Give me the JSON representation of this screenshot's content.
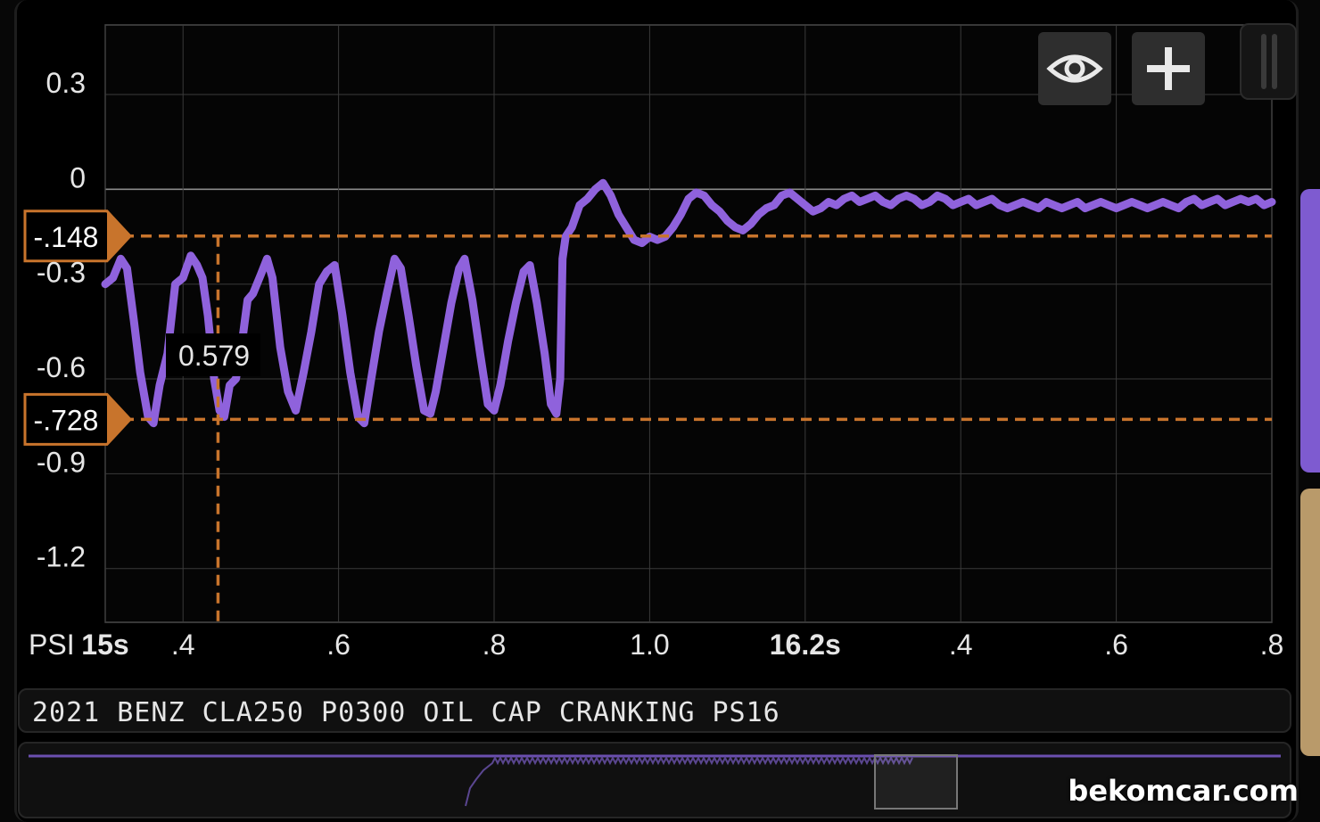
{
  "title_bar": {
    "text": "2021 BENZ CLA250 P0300 OIL CAP CRANKING PS16"
  },
  "toolbar": {
    "eye_icon": "eye-icon",
    "plus_icon": "plus-icon"
  },
  "watermark": "bekomcar.com",
  "colors": {
    "trace": "#8f62dc",
    "cursor": "#c8742c",
    "grid": "#3a3a3a",
    "background": "#000000"
  },
  "chart_data": {
    "type": "line",
    "ylabel": "PSI",
    "ylim": [
      -1.37,
      0.52
    ],
    "xlim": [
      15.3,
      16.8
    ],
    "y_ticks": [
      {
        "value": 0.3,
        "label": "0.3"
      },
      {
        "value": 0,
        "label": "0"
      },
      {
        "value": -0.3,
        "label": "-0.3"
      },
      {
        "value": -0.6,
        "label": "-0.6"
      },
      {
        "value": -0.9,
        "label": "-0.9"
      },
      {
        "value": -1.2,
        "label": "-1.2"
      }
    ],
    "x_ticks": [
      {
        "value": 15.3,
        "label": "15s",
        "bold": true
      },
      {
        "value": 15.4,
        "label": ".4"
      },
      {
        "value": 15.6,
        "label": ".6"
      },
      {
        "value": 15.8,
        "label": ".8"
      },
      {
        "value": 16.0,
        "label": "1.0"
      },
      {
        "value": 16.2,
        "label": "16.2s",
        "bold": true
      },
      {
        "value": 16.4,
        "label": ".4"
      },
      {
        "value": 16.6,
        "label": ".6"
      },
      {
        "value": 16.8,
        "label": ".8"
      }
    ],
    "cursors": {
      "horizontal": [
        {
          "value": -0.148,
          "label": "-.148"
        },
        {
          "value": -0.728,
          "label": "-.728"
        }
      ],
      "vertical": {
        "x": 15.445,
        "delta_label": "0.579"
      }
    },
    "series": [
      {
        "color": "#8f62dc",
        "points": [
          [
            15.3,
            -0.3
          ],
          [
            15.31,
            -0.28
          ],
          [
            15.32,
            -0.22
          ],
          [
            15.328,
            -0.25
          ],
          [
            15.337,
            -0.42
          ],
          [
            15.345,
            -0.58
          ],
          [
            15.355,
            -0.72
          ],
          [
            15.362,
            -0.74
          ],
          [
            15.37,
            -0.62
          ],
          [
            15.38,
            -0.52
          ],
          [
            15.39,
            -0.3
          ],
          [
            15.4,
            -0.28
          ],
          [
            15.41,
            -0.21
          ],
          [
            15.418,
            -0.24
          ],
          [
            15.425,
            -0.28
          ],
          [
            15.432,
            -0.4
          ],
          [
            15.44,
            -0.6
          ],
          [
            15.447,
            -0.7
          ],
          [
            15.453,
            -0.72
          ],
          [
            15.46,
            -0.62
          ],
          [
            15.468,
            -0.6
          ],
          [
            15.475,
            -0.5
          ],
          [
            15.483,
            -0.35
          ],
          [
            15.49,
            -0.33
          ],
          [
            15.5,
            -0.27
          ],
          [
            15.508,
            -0.22
          ],
          [
            15.515,
            -0.28
          ],
          [
            15.525,
            -0.5
          ],
          [
            15.535,
            -0.64
          ],
          [
            15.545,
            -0.7
          ],
          [
            15.555,
            -0.58
          ],
          [
            15.565,
            -0.45
          ],
          [
            15.575,
            -0.3
          ],
          [
            15.585,
            -0.26
          ],
          [
            15.595,
            -0.24
          ],
          [
            15.605,
            -0.4
          ],
          [
            15.615,
            -0.58
          ],
          [
            15.625,
            -0.72
          ],
          [
            15.633,
            -0.74
          ],
          [
            15.642,
            -0.6
          ],
          [
            15.652,
            -0.45
          ],
          [
            15.662,
            -0.33
          ],
          [
            15.672,
            -0.22
          ],
          [
            15.68,
            -0.25
          ],
          [
            15.69,
            -0.4
          ],
          [
            15.7,
            -0.56
          ],
          [
            15.71,
            -0.7
          ],
          [
            15.718,
            -0.71
          ],
          [
            15.725,
            -0.64
          ],
          [
            15.735,
            -0.5
          ],
          [
            15.745,
            -0.36
          ],
          [
            15.755,
            -0.25
          ],
          [
            15.762,
            -0.22
          ],
          [
            15.772,
            -0.35
          ],
          [
            15.782,
            -0.52
          ],
          [
            15.792,
            -0.68
          ],
          [
            15.8,
            -0.7
          ],
          [
            15.808,
            -0.62
          ],
          [
            15.818,
            -0.48
          ],
          [
            15.828,
            -0.36
          ],
          [
            15.838,
            -0.26
          ],
          [
            15.846,
            -0.24
          ],
          [
            15.855,
            -0.36
          ],
          [
            15.865,
            -0.52
          ],
          [
            15.873,
            -0.68
          ],
          [
            15.88,
            -0.71
          ],
          [
            15.885,
            -0.6
          ],
          [
            15.888,
            -0.22
          ],
          [
            15.892,
            -0.15
          ],
          [
            15.9,
            -0.12
          ],
          [
            15.91,
            -0.05
          ],
          [
            15.92,
            -0.03
          ],
          [
            15.93,
            0.0
          ],
          [
            15.94,
            0.02
          ],
          [
            15.95,
            -0.02
          ],
          [
            15.96,
            -0.08
          ],
          [
            15.97,
            -0.12
          ],
          [
            15.98,
            -0.16
          ],
          [
            15.99,
            -0.17
          ],
          [
            16.0,
            -0.15
          ],
          [
            16.01,
            -0.16
          ],
          [
            16.02,
            -0.15
          ],
          [
            16.03,
            -0.12
          ],
          [
            16.04,
            -0.08
          ],
          [
            16.05,
            -0.03
          ],
          [
            16.06,
            -0.01
          ],
          [
            16.07,
            -0.02
          ],
          [
            16.08,
            -0.05
          ],
          [
            16.09,
            -0.07
          ],
          [
            16.1,
            -0.1
          ],
          [
            16.11,
            -0.12
          ],
          [
            16.12,
            -0.13
          ],
          [
            16.13,
            -0.11
          ],
          [
            16.14,
            -0.08
          ],
          [
            16.15,
            -0.06
          ],
          [
            16.16,
            -0.05
          ],
          [
            16.17,
            -0.02
          ],
          [
            16.18,
            -0.01
          ],
          [
            16.19,
            -0.03
          ],
          [
            16.2,
            -0.05
          ],
          [
            16.21,
            -0.07
          ],
          [
            16.22,
            -0.06
          ],
          [
            16.23,
            -0.04
          ],
          [
            16.24,
            -0.05
          ],
          [
            16.25,
            -0.03
          ],
          [
            16.26,
            -0.02
          ],
          [
            16.27,
            -0.04
          ],
          [
            16.28,
            -0.03
          ],
          [
            16.29,
            -0.02
          ],
          [
            16.3,
            -0.04
          ],
          [
            16.31,
            -0.05
          ],
          [
            16.32,
            -0.03
          ],
          [
            16.33,
            -0.02
          ],
          [
            16.34,
            -0.03
          ],
          [
            16.35,
            -0.05
          ],
          [
            16.36,
            -0.04
          ],
          [
            16.37,
            -0.02
          ],
          [
            16.38,
            -0.03
          ],
          [
            16.39,
            -0.05
          ],
          [
            16.4,
            -0.04
          ],
          [
            16.41,
            -0.03
          ],
          [
            16.42,
            -0.05
          ],
          [
            16.43,
            -0.04
          ],
          [
            16.44,
            -0.03
          ],
          [
            16.45,
            -0.05
          ],
          [
            16.46,
            -0.06
          ],
          [
            16.47,
            -0.05
          ],
          [
            16.48,
            -0.04
          ],
          [
            16.49,
            -0.05
          ],
          [
            16.5,
            -0.06
          ],
          [
            16.51,
            -0.04
          ],
          [
            16.52,
            -0.05
          ],
          [
            16.53,
            -0.06
          ],
          [
            16.54,
            -0.05
          ],
          [
            16.55,
            -0.04
          ],
          [
            16.56,
            -0.06
          ],
          [
            16.57,
            -0.05
          ],
          [
            16.58,
            -0.04
          ],
          [
            16.59,
            -0.05
          ],
          [
            16.6,
            -0.06
          ],
          [
            16.61,
            -0.05
          ],
          [
            16.62,
            -0.04
          ],
          [
            16.63,
            -0.05
          ],
          [
            16.64,
            -0.06
          ],
          [
            16.65,
            -0.05
          ],
          [
            16.66,
            -0.04
          ],
          [
            16.67,
            -0.05
          ],
          [
            16.68,
            -0.06
          ],
          [
            16.69,
            -0.04
          ],
          [
            16.7,
            -0.03
          ],
          [
            16.71,
            -0.05
          ],
          [
            16.72,
            -0.04
          ],
          [
            16.73,
            -0.03
          ],
          [
            16.74,
            -0.05
          ],
          [
            16.75,
            -0.04
          ],
          [
            16.76,
            -0.03
          ],
          [
            16.77,
            -0.04
          ],
          [
            16.78,
            -0.03
          ],
          [
            16.79,
            -0.05
          ],
          [
            16.8,
            -0.04
          ]
        ]
      }
    ]
  }
}
